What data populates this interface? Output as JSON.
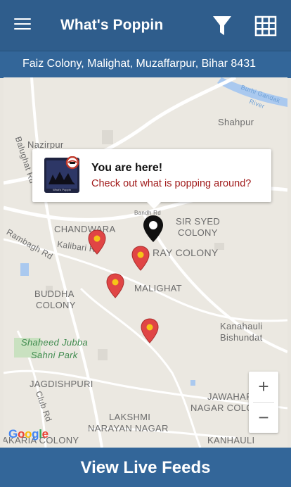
{
  "appbar": {
    "title": "What's Poppin",
    "menu_icon": "hamburger-menu-icon",
    "filter_icon": "filter-icon",
    "grid_icon": "grid-icon"
  },
  "address": "Faiz Colony, Malighat, Muzaffarpur, Bihar 8431",
  "popup": {
    "title": "You are here!",
    "subtitle": "Check out what is popping around?",
    "logo_caption": "What's Poppin"
  },
  "map": {
    "places": {
      "shahpur": "Shahpur",
      "nazirpur": "Nazirpur",
      "balughat": "Balughat Rd",
      "river": "Burhi Gandak River",
      "bandh_rd": "Bandh Rd",
      "sir_syed_1": "SIR SYED",
      "sir_syed_2": "COLONY",
      "chandwara": "CHANDWARA",
      "kalibari": "Kalibari Rd",
      "rambagh": "Rambagh Rd",
      "ray_colony": "RAY COLONY",
      "malighat": "MALIGHAT",
      "buddha_1": "BUDDHA",
      "buddha_2": "COLONY",
      "kanahauli_1": "Kanahauli",
      "kanahauli_2": "Bishundat",
      "shaheed_1": "Shaheed Jubba",
      "shaheed_2": "Sahni Park",
      "jagdishpuri": "JAGDISHPURI",
      "club_rd": "Club Rd",
      "jawahar_1": "JAWAHAR",
      "jawahar_2": "NAGAR COLONY",
      "lakshmi_1": "LAKSHMI",
      "lakshmi_2": "NARAYAN NAGAR",
      "akaria": "AKARIA COLONY",
      "kanhauli": "KANHAULI"
    },
    "zoom_in": "+",
    "zoom_out": "−",
    "attribution": "Google",
    "colors": {
      "pin": "#e04545",
      "pin_dot": "#f5c518",
      "you_pin": "#111111"
    }
  },
  "footer": {
    "label": "View Live Feeds"
  },
  "colors": {
    "appbar": "#2f5d8c",
    "addressbar": "#336699",
    "footer": "#336699"
  }
}
